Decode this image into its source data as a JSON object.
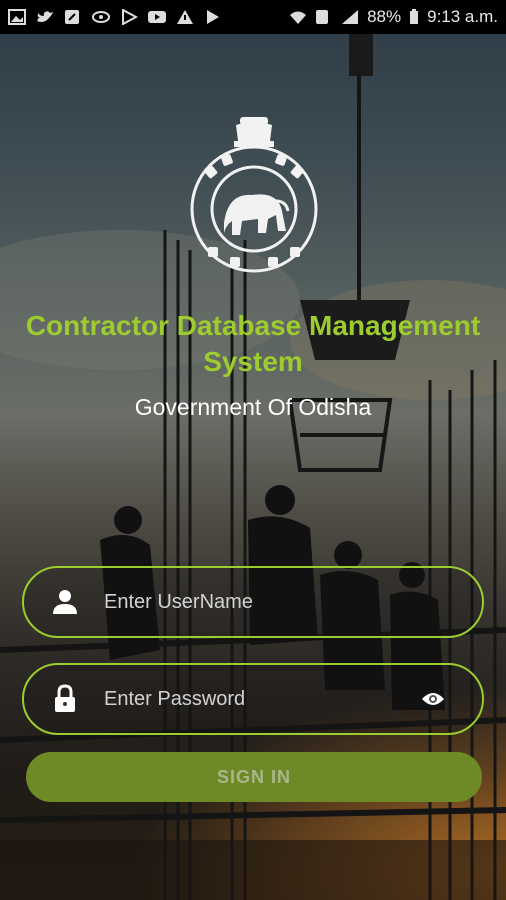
{
  "status_bar": {
    "battery": "88%",
    "time": "9:13 a.m.",
    "icons": [
      "gallery-icon",
      "twitter-icon",
      "edit-icon",
      "eye-icon",
      "play-store-icon",
      "youtube-icon",
      "warning-icon",
      "play-icon",
      "wifi-icon",
      "sim-1-icon",
      "signal-icon",
      "battery-icon"
    ]
  },
  "branding": {
    "title": "Contractor Database Management System",
    "subtitle": "Government Of Odisha",
    "emblem_icon": "odisha-state-emblem"
  },
  "form": {
    "username_placeholder": "Enter UserName",
    "password_placeholder": "Enter Password",
    "signin_label": "SIGN IN"
  },
  "colors": {
    "accent": "#9ccc2e",
    "button_bg": "#6e8a27",
    "button_text": "#a9b68e"
  }
}
